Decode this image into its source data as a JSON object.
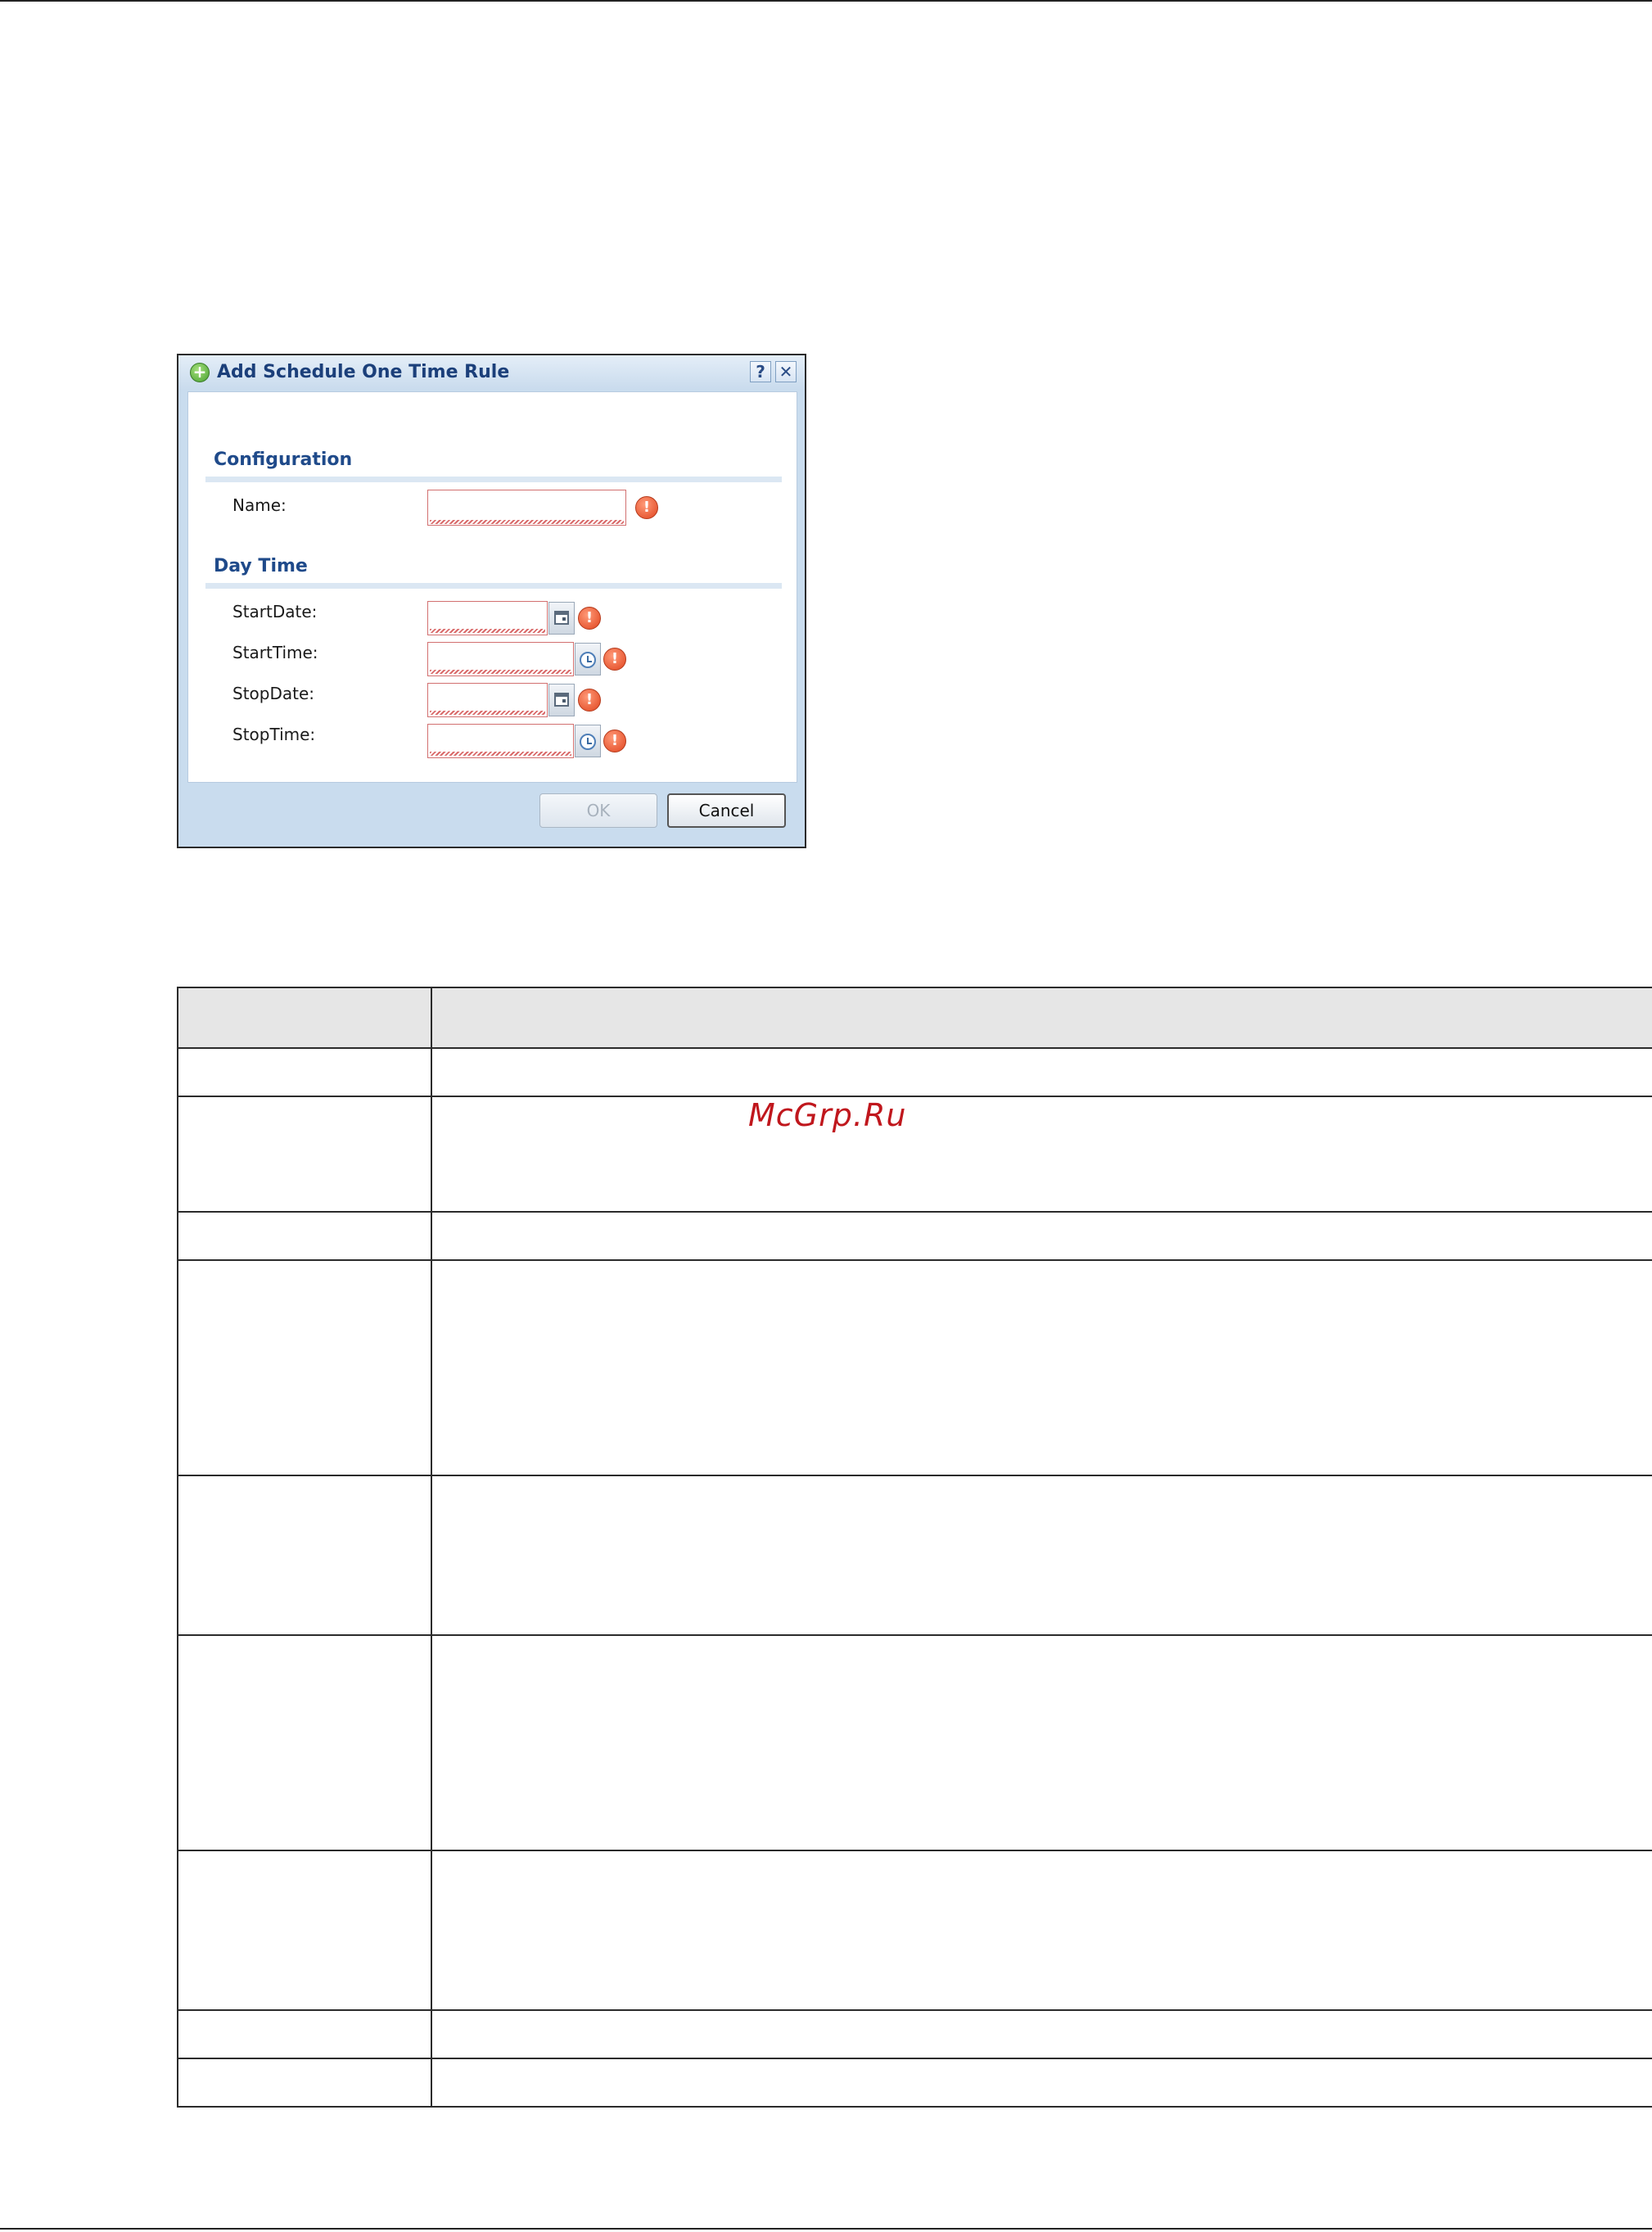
{
  "dialog": {
    "title": "Add Schedule One Time Rule",
    "help_label": "?",
    "close_label": "✕",
    "sections": {
      "configuration": "Configuration",
      "day_time": "Day Time"
    },
    "fields": {
      "name_label": "Name:",
      "start_date_label": "StartDate:",
      "start_time_label": "StartTime:",
      "stop_date_label": "StopDate:",
      "stop_time_label": "StopTime:"
    },
    "ok_label": "OK",
    "cancel_label": "Cancel",
    "error_glyph": "!"
  },
  "watermark": "McGrp.Ru",
  "icons": {
    "title": "add-green-circle-icon",
    "error": "error-exclamation-icon",
    "date_picker": "calendar-icon",
    "time_picker": "clock-icon"
  },
  "colors": {
    "title_text": "#1b3f7a",
    "section_text": "#1f4a8a",
    "invalid_border": "#d27070",
    "error_icon": "#e0441e",
    "watermark": "#c0171d"
  }
}
